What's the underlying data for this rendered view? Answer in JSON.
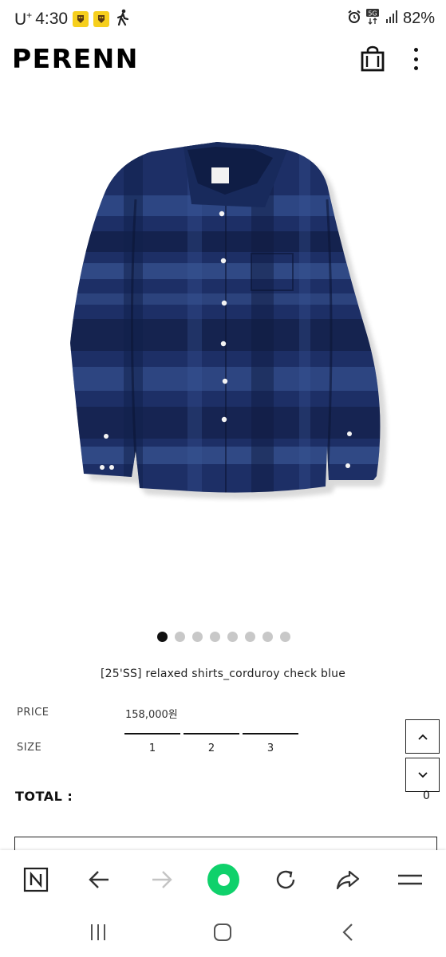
{
  "status_bar": {
    "carrier": "U",
    "carrier_sup": "+",
    "time": "4:30",
    "network": "5G",
    "battery": "82%"
  },
  "header": {
    "logo": "PERENN",
    "cart_icon": "shopping-bag-icon",
    "menu_icon": "more-vertical-icon"
  },
  "carousel": {
    "total": 8,
    "active_index": 0
  },
  "product": {
    "title": "[25'SS] relaxed shirts_corduroy check blue",
    "price_label": "PRICE",
    "price": "158,000원",
    "size_label": "SIZE",
    "sizes": [
      "1",
      "2",
      "3"
    ],
    "total_label": "TOTAL :",
    "total_value": "0"
  },
  "scroll_buttons": {
    "up_icon": "chevron-up-icon",
    "down_icon": "chevron-down-icon"
  },
  "browser_toolbar": {
    "items": [
      "naver-n-icon",
      "back-arrow-icon",
      "forward-arrow-icon",
      "home-green-icon",
      "refresh-icon",
      "share-icon",
      "menu-icon"
    ],
    "home_color": "#0fd16b"
  },
  "colors": {
    "shirt": "#1d2f66",
    "text": "#222222"
  }
}
